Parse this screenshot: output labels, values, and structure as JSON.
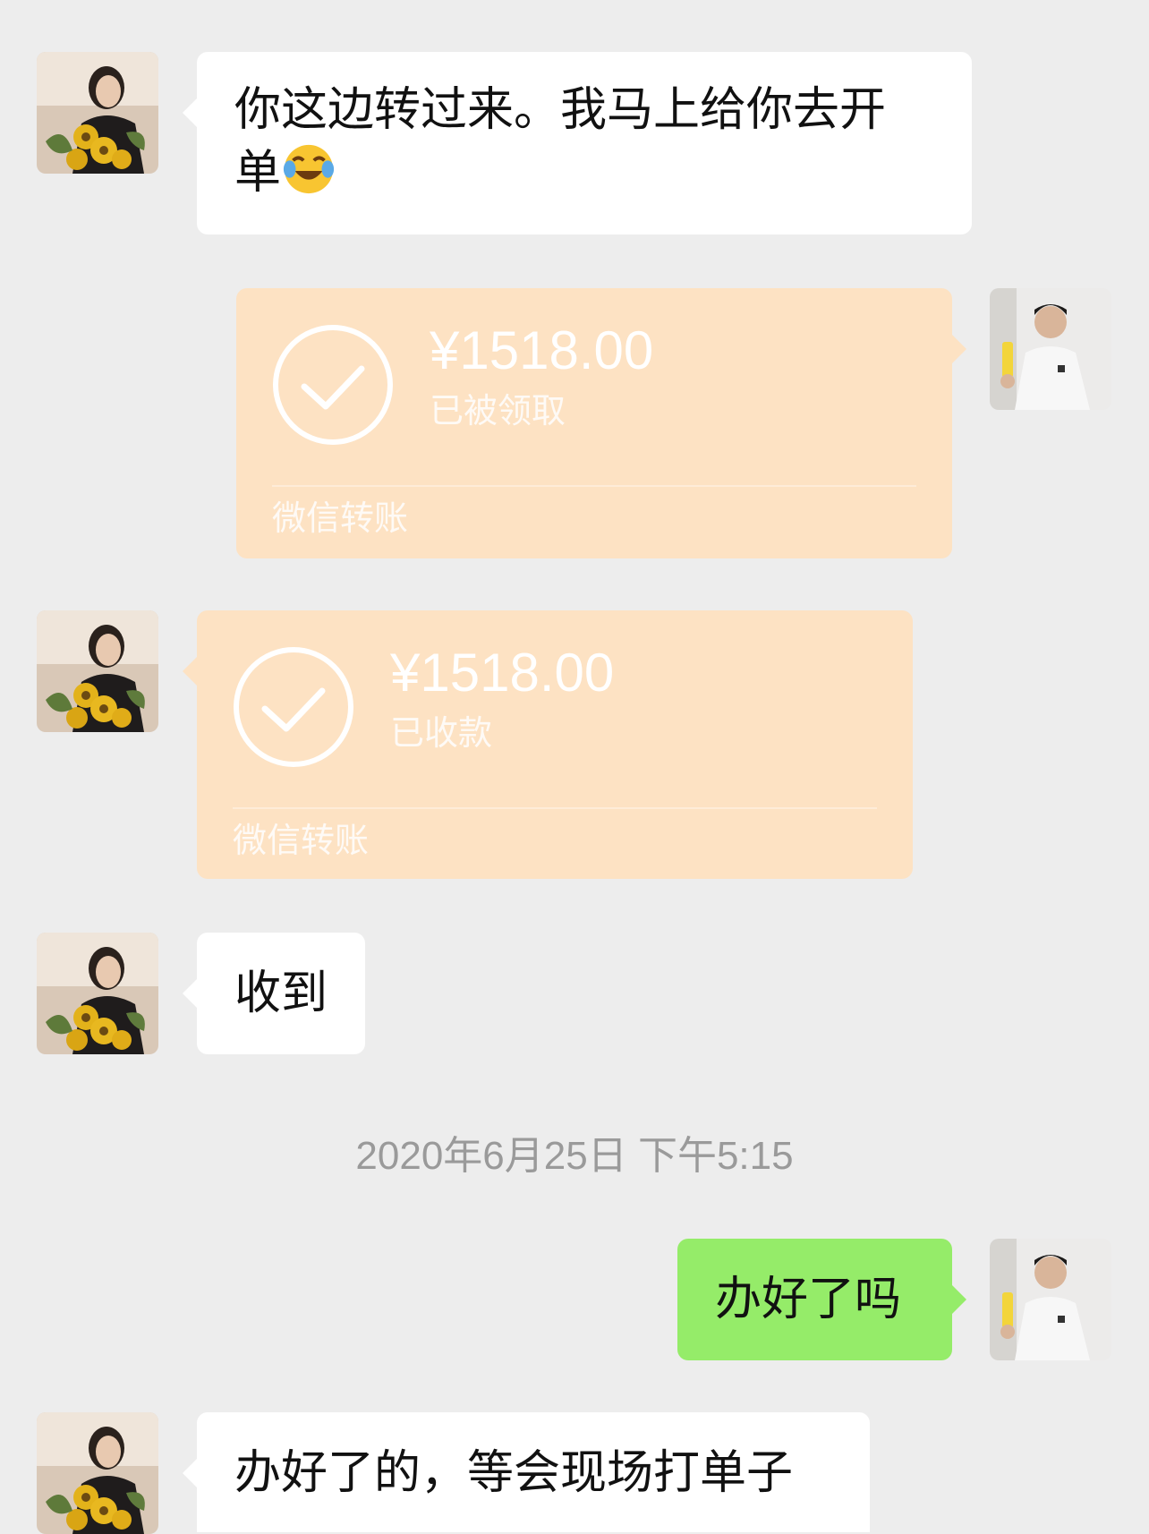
{
  "messages": [
    {
      "sender": "contact",
      "type": "text",
      "text_line1": "你这边转过来。我马上给你去开",
      "text_line2": "单",
      "emoji": "face-with-tears-of-joy-icon"
    },
    {
      "sender": "me",
      "type": "transfer",
      "amount": "¥1518.00",
      "status": "已被领取",
      "label": "微信转账"
    },
    {
      "sender": "contact",
      "type": "transfer",
      "amount": "¥1518.00",
      "status": "已收款",
      "label": "微信转账"
    },
    {
      "sender": "contact",
      "type": "text",
      "text": "收到"
    },
    {
      "type": "timestamp",
      "text": "2020年6月25日 下午5:15"
    },
    {
      "sender": "me",
      "type": "text",
      "text": "办好了吗"
    },
    {
      "sender": "contact",
      "type": "text",
      "text": "办好了的，等会现场打单子"
    }
  ],
  "colors": {
    "background": "#ededed",
    "incoming_bubble": "#ffffff",
    "outgoing_bubble": "#95ec69",
    "transfer_card": "#fde2c3",
    "timestamp_text": "#9a9a9a"
  }
}
